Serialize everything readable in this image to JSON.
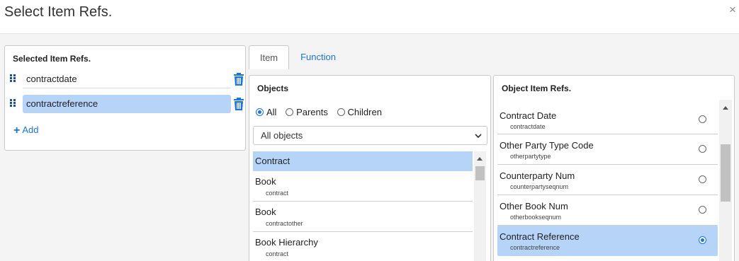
{
  "modal": {
    "title": "Select Item Refs.",
    "close_label": "×"
  },
  "selected_panel": {
    "title": "Selected Item Refs.",
    "items": [
      {
        "label": "contractdate",
        "active": false
      },
      {
        "label": "contractreference",
        "active": true
      }
    ],
    "add_label": "Add"
  },
  "tabs": [
    {
      "label": "Item",
      "active": true
    },
    {
      "label": "Function",
      "active": false
    }
  ],
  "objects_panel": {
    "title": "Objects",
    "radio_options": [
      {
        "label": "All",
        "checked": true
      },
      {
        "label": "Parents",
        "checked": false
      },
      {
        "label": "Children",
        "checked": false
      }
    ],
    "filter_value": "All objects",
    "items": [
      {
        "name": "Contract",
        "sub": "",
        "selected": true
      },
      {
        "name": "Book",
        "sub": "contract",
        "selected": false
      },
      {
        "name": "Book",
        "sub": "contractother",
        "selected": false
      },
      {
        "name": "Book Hierarchy",
        "sub": "contract",
        "selected": false
      }
    ]
  },
  "refs_panel": {
    "title": "Object Item Refs.",
    "items": [
      {
        "name": "Contract Date",
        "sub": "contractdate",
        "selected": false
      },
      {
        "name": "Other Party Type Code",
        "sub": "otherpartytype",
        "selected": false
      },
      {
        "name": "Counterparty Num",
        "sub": "counterpartyseqnum",
        "selected": false
      },
      {
        "name": "Other Book Num",
        "sub": "otherbookseqnum",
        "selected": false
      },
      {
        "name": "Contract Reference",
        "sub": "contractreference",
        "selected": true
      }
    ]
  },
  "colors": {
    "accent": "#1a73e8",
    "selection": "#b5d4f7",
    "handle": "#1a4fa3"
  },
  "icons": {
    "close": "close-icon",
    "drag": "drag-handle-icon",
    "delete": "trash-icon",
    "add": "plus-icon",
    "dropdown": "chevron-down-icon"
  }
}
